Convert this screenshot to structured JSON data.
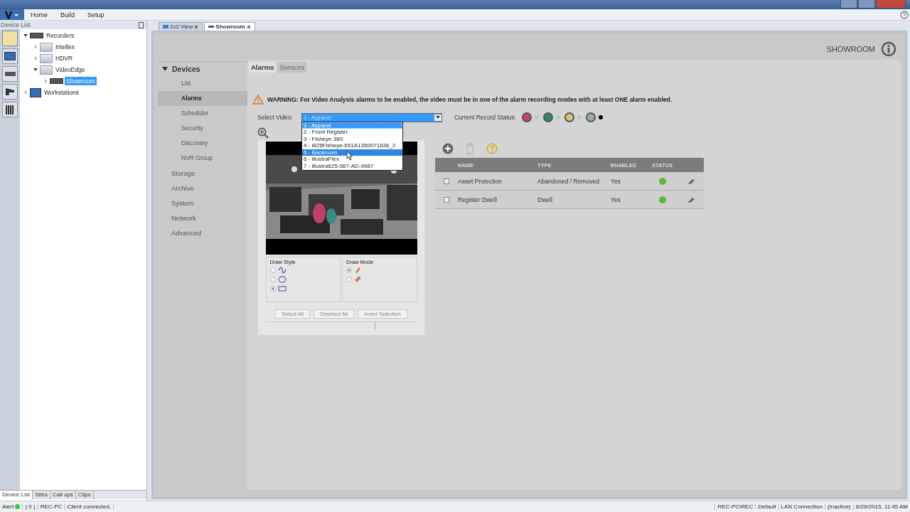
{
  "menu": [
    "Home",
    "Build",
    "Setup"
  ],
  "device_list": {
    "title": "Device List",
    "tree": [
      {
        "label": "Recorders",
        "kind": "recorder",
        "expanded": true,
        "selected": false,
        "children": [
          {
            "label": "Intellex",
            "kind": "folder",
            "expanded": false,
            "selected": false
          },
          {
            "label": "HDVR",
            "kind": "folder",
            "expanded": false,
            "selected": false
          },
          {
            "label": "VideoEdge",
            "kind": "folder",
            "expanded": true,
            "selected": false,
            "children": [
              {
                "label": "Showroom",
                "kind": "recorder",
                "expanded": false,
                "selected": true
              }
            ]
          }
        ]
      },
      {
        "label": "Workstations",
        "kind": "workstation",
        "expanded": false,
        "selected": false
      }
    ]
  },
  "doc_tabs": [
    {
      "label": "2x2 View",
      "selected": false
    },
    {
      "label": "Showroom",
      "selected": true
    }
  ],
  "header": "SHOWROOM",
  "nav": [
    {
      "label": "Devices",
      "expanded": true,
      "children": [
        {
          "label": "List",
          "selected": false
        },
        {
          "label": "Alarms",
          "selected": true
        },
        {
          "label": "Scheduler",
          "selected": false
        },
        {
          "label": "Security",
          "selected": false
        },
        {
          "label": "Discovery",
          "selected": false
        },
        {
          "label": "NVR Group",
          "selected": false
        }
      ]
    },
    {
      "label": "Storage"
    },
    {
      "label": "Archive"
    },
    {
      "label": "System"
    },
    {
      "label": "Network"
    },
    {
      "label": "Advanced"
    }
  ],
  "panel_tabs": [
    {
      "label": "Alarms",
      "selected": true
    },
    {
      "label": "Sensors",
      "selected": false
    }
  ],
  "warning": "WARNING: For Video Analysis alarms to be enabled, the video must be in one of the alarm recording modes with at least ONE alarm enabled.",
  "select_video": {
    "label": "Select Video:",
    "value": "1 - Apparel",
    "options": [
      {
        "label": "1 - Apparel",
        "selected": true,
        "hovered": false
      },
      {
        "label": "2 - Front Register",
        "selected": false,
        "hovered": false
      },
      {
        "label": "3 - Fisheye 360",
        "selected": false,
        "hovered": false
      },
      {
        "label": "4 - i825Fisheye-651A1350071636_2",
        "selected": false,
        "hovered": false
      },
      {
        "label": "5 - Backroom",
        "selected": false,
        "hovered": true
      },
      {
        "label": "6 - illustraFlex",
        "selected": false,
        "hovered": false
      },
      {
        "label": "7 - illustra625-567-AD-9987",
        "selected": false,
        "hovered": false
      }
    ]
  },
  "record_status": {
    "label": "Current Record Status:",
    "modes": [
      {
        "color": "#c8455f",
        "on": false
      },
      {
        "color": "#2f8a5c",
        "on": false
      },
      {
        "color": "#d8c27a",
        "on": false
      },
      {
        "color": "#8fb39a",
        "on": true
      }
    ]
  },
  "draw_style": {
    "label": "Draw Style",
    "options": [
      {
        "kind": "freehand",
        "selected": false
      },
      {
        "kind": "polygon",
        "selected": false
      },
      {
        "kind": "rectangle",
        "selected": true
      }
    ]
  },
  "draw_mode": {
    "label": "Draw Mode",
    "options": [
      {
        "kind": "pencil",
        "selected": true
      },
      {
        "kind": "eraser",
        "selected": false
      }
    ]
  },
  "selection_buttons": [
    "Select All",
    "Deselect All",
    "Invert Selection"
  ],
  "alarms": {
    "columns": [
      "NAME",
      "TYPE",
      "ENABLED",
      "STATUS"
    ],
    "rows": [
      {
        "checked": false,
        "name": "Asset Protection",
        "type": "Abandoned / Removed",
        "enabled": "Yes",
        "color": "#5cb82e"
      },
      {
        "checked": false,
        "name": "Register Dwell",
        "type": "Dwell",
        "enabled": "Yes",
        "color": "#5cb82e"
      }
    ]
  },
  "bottom_tabs": [
    {
      "label": "Device List",
      "selected": true
    },
    {
      "label": "Sites",
      "selected": false
    },
    {
      "label": "Call ups",
      "selected": false
    },
    {
      "label": "Clips",
      "selected": false
    }
  ],
  "status_left": [
    "Alert",
    "( 0 )",
    "REC-PC",
    "Client connected."
  ],
  "status_right": [
    "REC-PC\\REC",
    "Default",
    "LAN Connection",
    "(Inactive)",
    "6/29/2015, 11:45 AM"
  ]
}
